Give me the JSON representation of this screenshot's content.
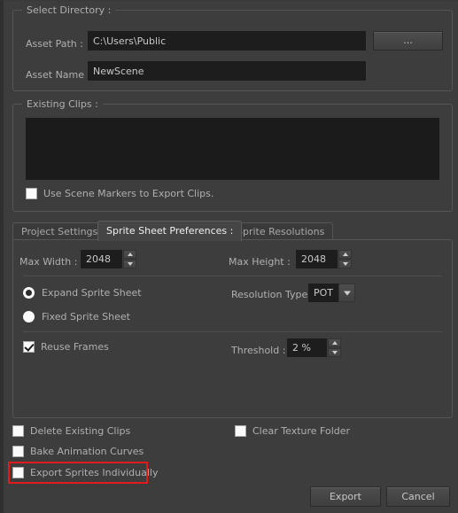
{
  "directory_group": {
    "title": "Select Directory :",
    "asset_path_label": "Asset Path :",
    "asset_path_value": "C:\\Users\\Public",
    "browse_button_label": "...",
    "asset_name_label": "Asset Name :",
    "asset_name_value": "NewScene"
  },
  "clips_group": {
    "title": "Existing Clips :",
    "list_items": [],
    "use_scene_markers_label": "Use Scene Markers to Export Clips.",
    "use_scene_markers_checked": false
  },
  "tabs": [
    {
      "label": "Project Settings",
      "active": false
    },
    {
      "label": "Sprite Sheet Preferences :",
      "active": true
    },
    {
      "label": "Sprite Resolutions",
      "active": false
    }
  ],
  "sprite_sheet": {
    "max_width_label": "Max Width :",
    "max_width_value": "2048",
    "max_height_label": "Max Height :",
    "max_height_value": "2048",
    "expand_sprite_sheet_label": "Expand Sprite Sheet",
    "expand_sprite_sheet_selected": true,
    "fixed_sprite_sheet_label": "Fixed Sprite Sheet",
    "fixed_sprite_sheet_selected": false,
    "resolution_type_label": "Resolution Type",
    "resolution_type_value": "POT",
    "reuse_frames_label": "Reuse Frames",
    "reuse_frames_checked": true,
    "threshold_label": "Threshold :",
    "threshold_value": "2 %"
  },
  "bottom_options": {
    "delete_existing_clips_label": "Delete Existing Clips",
    "delete_existing_clips_checked": false,
    "bake_animation_curves_label": "Bake Animation Curves",
    "bake_animation_curves_checked": false,
    "export_sprites_individually_label": "Export Sprites Individually",
    "export_sprites_individually_checked": false,
    "clear_texture_folder_label": "Clear Texture Folder",
    "clear_texture_folder_checked": false
  },
  "actions": {
    "export_label": "Export",
    "cancel_label": "Cancel"
  },
  "annotation": {
    "highlight_color": "#e01b1b"
  }
}
